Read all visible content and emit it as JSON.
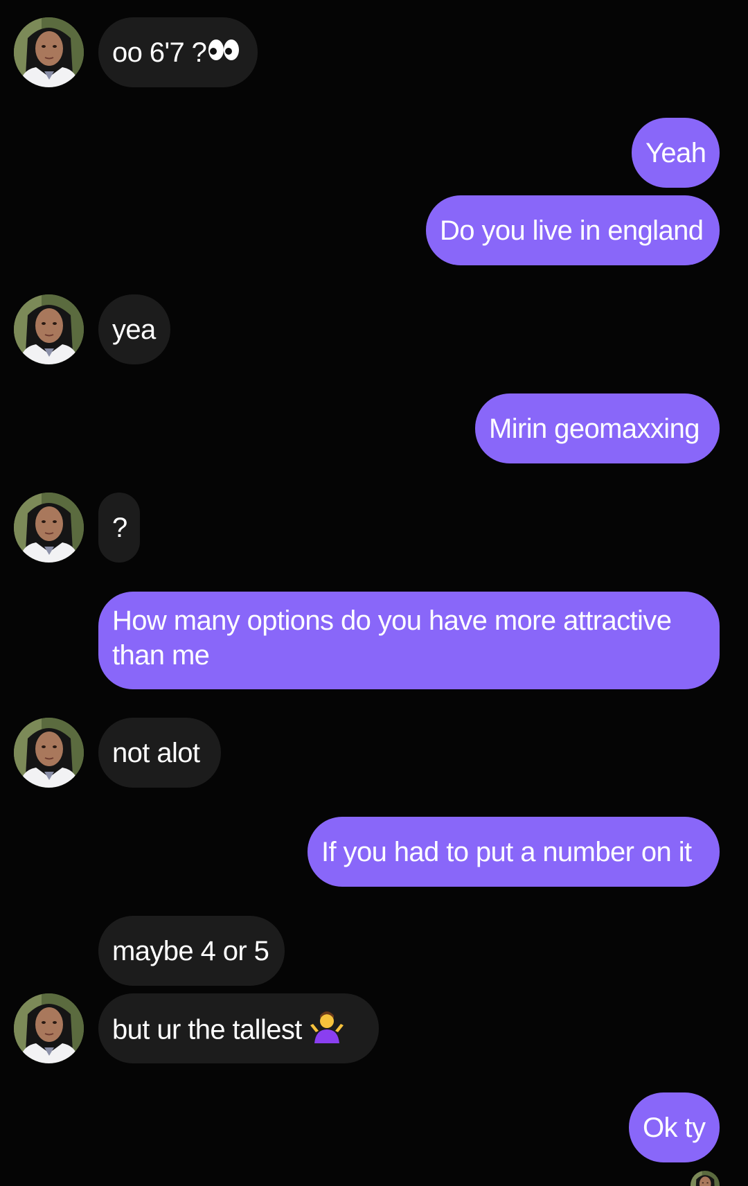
{
  "conversation": {
    "messages": [
      {
        "from": "them",
        "text": "oo 6'7 ?",
        "emoji": "eyes"
      },
      {
        "from": "me",
        "text": "Yeah"
      },
      {
        "from": "me",
        "text": "Do you live in england"
      },
      {
        "from": "them",
        "text": "yea"
      },
      {
        "from": "me",
        "text": "Mirin geomaxxing"
      },
      {
        "from": "them",
        "text": "?"
      },
      {
        "from": "me",
        "text": "How many options do you have more attractive than me"
      },
      {
        "from": "them",
        "text": "not alot"
      },
      {
        "from": "me",
        "text": "If you had to put a number on it"
      },
      {
        "from": "them",
        "text": "maybe 4 or 5"
      },
      {
        "from": "them",
        "text": "but ur the tallest",
        "emoji": "person-shrugging"
      },
      {
        "from": "me",
        "text": "Ok ty"
      }
    ]
  },
  "colors": {
    "background": "#050505",
    "incoming_bubble": "#1c1c1c",
    "outgoing_bubble": "#8967f9",
    "text": "#ffffff"
  }
}
